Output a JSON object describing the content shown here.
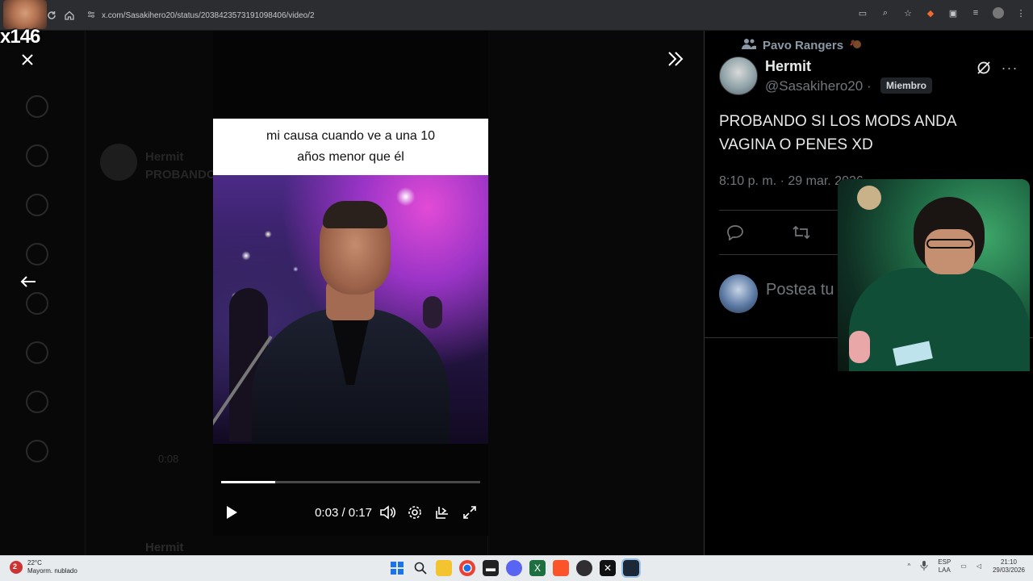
{
  "browser": {
    "url": "x.com/Sasakihero20/status/2038423573191098406/video/2"
  },
  "stream": {
    "counter": "x146"
  },
  "background": {
    "tweet_author": "Hermit",
    "tweet_snippet": "PROBANDO",
    "bottom_author": "Hermit",
    "time_ghost": "0:08"
  },
  "video": {
    "caption": "mi causa cuando ve a una 10 años menor que él",
    "time": "0:03 / 0:17",
    "progress": 0.21
  },
  "detail": {
    "community": "Pavo Rangers",
    "author_name": "Hermit",
    "author_handle": "@Sasakihero20 ·",
    "badge": "Miembro",
    "text": "PROBANDO SI LOS MODS ANDA VAGINA O PENES XD",
    "meta": "8:10 p. m. · 29 mar. 2026",
    "reply_placeholder": "Postea tu respuesta"
  },
  "taskbar": {
    "weather_temp": "22°C",
    "weather_desc": "Mayorm. nublado",
    "weather_badge": "2",
    "lang_top": "ESP",
    "lang_bottom": "LAA",
    "clock_time": "21:10",
    "clock_date": "29/03/2026"
  },
  "colors": {
    "accent": "#1d9bf0",
    "panel_bg": "#000000",
    "muted_text": "#71767b"
  }
}
